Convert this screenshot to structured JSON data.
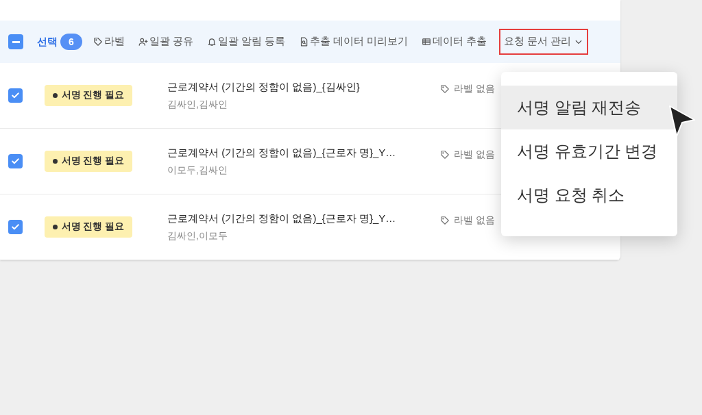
{
  "toolbar": {
    "select_all": {
      "indeterminate": true
    },
    "selection_label": "선택",
    "selection_count": "6",
    "actions": [
      {
        "label": "라벨",
        "highlighted": false,
        "dropdown": false
      },
      {
        "label": "일괄 공유",
        "highlighted": false,
        "dropdown": false
      },
      {
        "label": "일괄 알림 등록",
        "highlighted": false,
        "dropdown": false
      },
      {
        "label": "추출 데이터 미리보기",
        "highlighted": false,
        "dropdown": false
      },
      {
        "label": "데이터 추출",
        "highlighted": false,
        "dropdown": false
      },
      {
        "label": "요청 문서 관리",
        "highlighted": true,
        "dropdown": true
      }
    ]
  },
  "rows": [
    {
      "checked": true,
      "status": "서명 진행 필요",
      "title": "근로계약서 (기간의 정함이 없음)_{김싸인}",
      "participants": "김싸인,김싸인",
      "label": "라벨 없음"
    },
    {
      "checked": true,
      "status": "서명 진행 필요",
      "title": "근로계약서 (기간의 정함이 없음)_{근로자 명}_Y…",
      "participants": "이모두,김싸인",
      "label": "라벨 없음"
    },
    {
      "checked": true,
      "status": "서명 진행 필요",
      "title": "근로계약서 (기간의 정함이 없음)_{근로자 명}_Y…",
      "participants": "김싸인,이모두",
      "label": "라벨 없음"
    }
  ],
  "dropdown_menu": {
    "items": [
      {
        "label": "서명 알림 재전송",
        "hovered": true
      },
      {
        "label": "서명 유효기간 변경",
        "hovered": false
      },
      {
        "label": "서명 요청 취소",
        "hovered": false
      }
    ]
  }
}
